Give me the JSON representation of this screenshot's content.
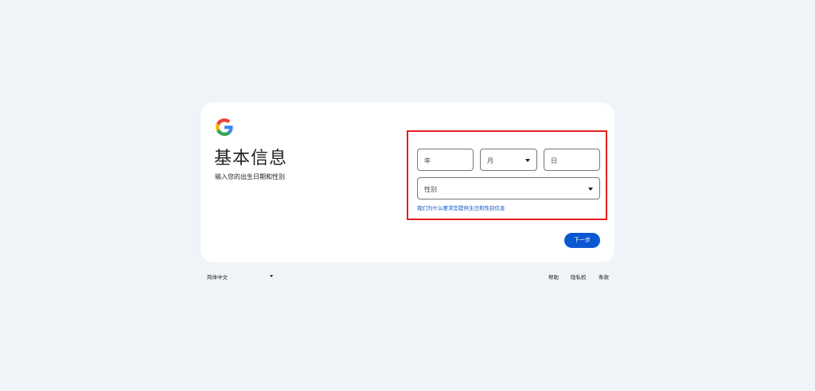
{
  "page": {
    "title": "基本信息",
    "subtitle": "输入您的出生日期和性别"
  },
  "form": {
    "year_placeholder": "年",
    "month_placeholder": "月",
    "day_placeholder": "日",
    "gender_placeholder": "性别",
    "why_link": "我们为什么要求您提供生日和性别信息",
    "next_label": "下一步"
  },
  "footer": {
    "language": "简体中文",
    "help": "帮助",
    "privacy": "隐私权",
    "terms": "条款"
  },
  "icons": {
    "logo": "google-g-logo",
    "dropdown": "dropdown-caret"
  },
  "colors": {
    "background": "#f0f4f9",
    "card": "#ffffff",
    "accent": "#0b57d0",
    "highlight_border": "#e3201b"
  }
}
